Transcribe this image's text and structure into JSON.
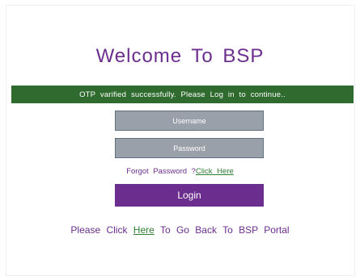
{
  "colors": {
    "brand_purple": "#6b2e8f",
    "banner_green": "#2f6b2f",
    "link_green": "#2e7d32",
    "field_gray": "#9aa0a9"
  },
  "page": {
    "title": "Welcome To BSP"
  },
  "banner": {
    "message": "OTP varified successfully. Please Log in to continue.."
  },
  "form": {
    "username_placeholder": "Username",
    "password_placeholder": "Password",
    "forgot_text": "Forgot Password ?",
    "forgot_link": "Click Here",
    "login_label": "Login"
  },
  "footer": {
    "prefix": "Please Click",
    "link": "Here",
    "suffix": "To Go Back To BSP Portal"
  }
}
